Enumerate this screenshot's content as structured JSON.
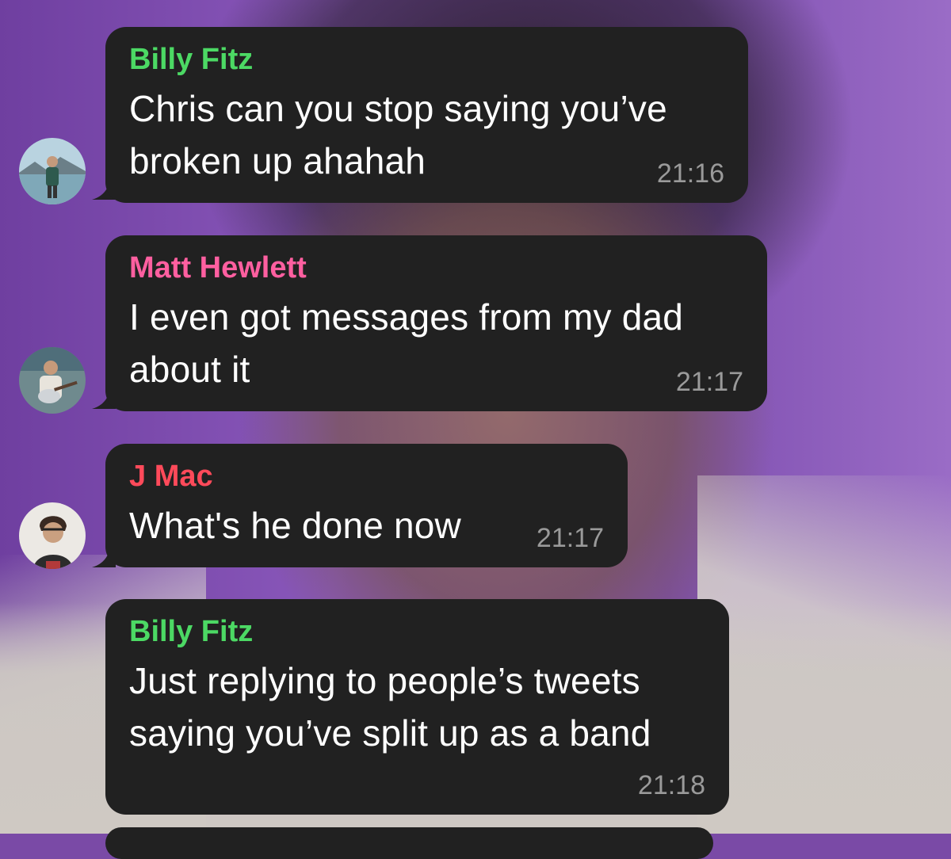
{
  "chat": {
    "messages": [
      {
        "sender": "Billy Fitz",
        "sender_color": "#4cd964",
        "lines": [
          "Chris can you stop saying you’ve",
          "broken up ahahah"
        ],
        "time": "21:16",
        "avatar_icon": "person-outdoors-lake-avatar"
      },
      {
        "sender": "Matt Hewlett",
        "sender_color": "#ff5fa0",
        "lines": [
          "I even got messages from my dad",
          "about it"
        ],
        "time": "21:17",
        "avatar_icon": "person-with-guitar-avatar"
      },
      {
        "sender": "J Mac",
        "sender_color": "#ff4a5a",
        "lines": [
          "What's he done now"
        ],
        "time": "21:17",
        "avatar_icon": "person-portrait-avatar"
      },
      {
        "sender": "Billy Fitz",
        "sender_color": "#4cd964",
        "lines": [
          "Just replying to people’s tweets",
          "saying you’ve split up as a band"
        ],
        "time": "21:18",
        "avatar_icon": null
      }
    ]
  },
  "colors": {
    "bubble_bg": "#212121",
    "text": "#ffffff",
    "timestamp": "#9a9a9a"
  }
}
